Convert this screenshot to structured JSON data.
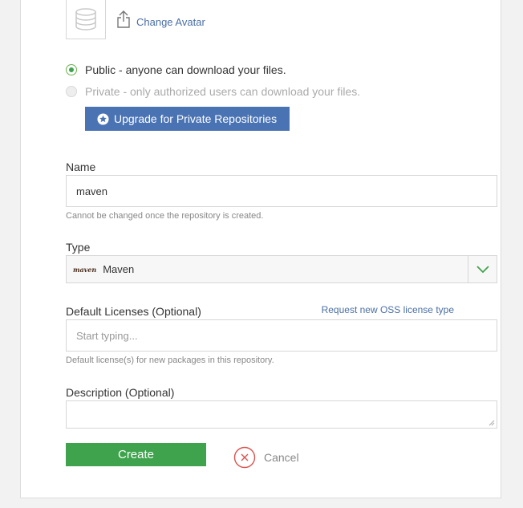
{
  "avatar": {
    "icon": "database-icon",
    "change_label": "Change Avatar"
  },
  "visibility": {
    "public_label": "Public - anyone can download your files.",
    "private_label": "Private - only authorized users can download your files.",
    "selected": "public",
    "upgrade_label": "Upgrade for Private Repositories"
  },
  "name_field": {
    "label": "Name",
    "value": "maven",
    "help": "Cannot be changed once the repository is created."
  },
  "type_field": {
    "label": "Type",
    "logo_text": "maven",
    "value": "Maven"
  },
  "licenses_field": {
    "label": "Default Licenses (Optional)",
    "request_link": "Request new OSS license type",
    "placeholder": "Start typing...",
    "help": "Default license(s) for new packages in this repository."
  },
  "description_field": {
    "label": "Description (Optional)",
    "value": ""
  },
  "actions": {
    "create_label": "Create",
    "cancel_label": "Cancel"
  },
  "colors": {
    "primary_blue": "#4a73b4",
    "link_blue": "#4a6fa5",
    "create_green": "#3fa34d",
    "cancel_red": "#d9534f"
  }
}
